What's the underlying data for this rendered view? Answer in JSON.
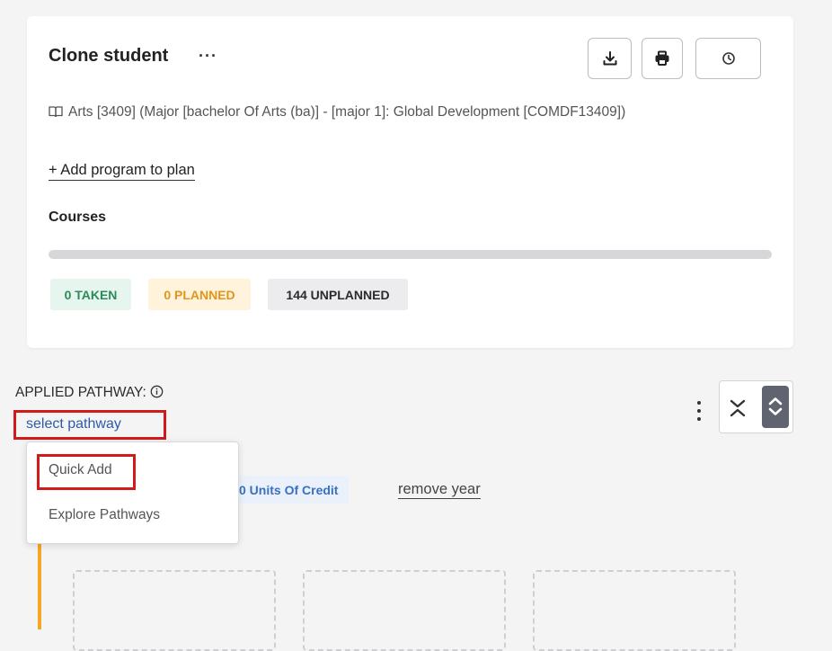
{
  "plan": {
    "title": "Clone student",
    "more_label": "···",
    "program": "Arts [3409] (Major [bachelor Of Arts (ba)] - [major 1]: Global Development [COMDF13409])",
    "add_program_label": "+ Add program to plan",
    "courses_heading": "Courses",
    "badges": {
      "taken": "0 TAKEN",
      "planned": "0 PLANNED",
      "unplanned": "144 UNPLANNED"
    }
  },
  "toolbar_icons": [
    "download-icon",
    "printer-icon",
    "clock-icon"
  ],
  "pathway": {
    "applied_label": "APPLIED PATHWAY:",
    "select_label": "select pathway",
    "menu": [
      "Quick Add",
      "Explore Pathways"
    ]
  },
  "year": {
    "units_label": "0 Units Of Credit",
    "remove_label": "remove year"
  },
  "colors": {
    "taken_bg": "#e6f5ee",
    "taken_fg": "#2f8a5a",
    "planned_bg": "#fff3dc",
    "planned_fg": "#e0961c",
    "unplanned_bg": "#ececee",
    "unplanned_fg": "#2b2b2b",
    "link": "#2e5aa7",
    "highlight": "#d11b1b",
    "timeline": "#f5a623"
  }
}
